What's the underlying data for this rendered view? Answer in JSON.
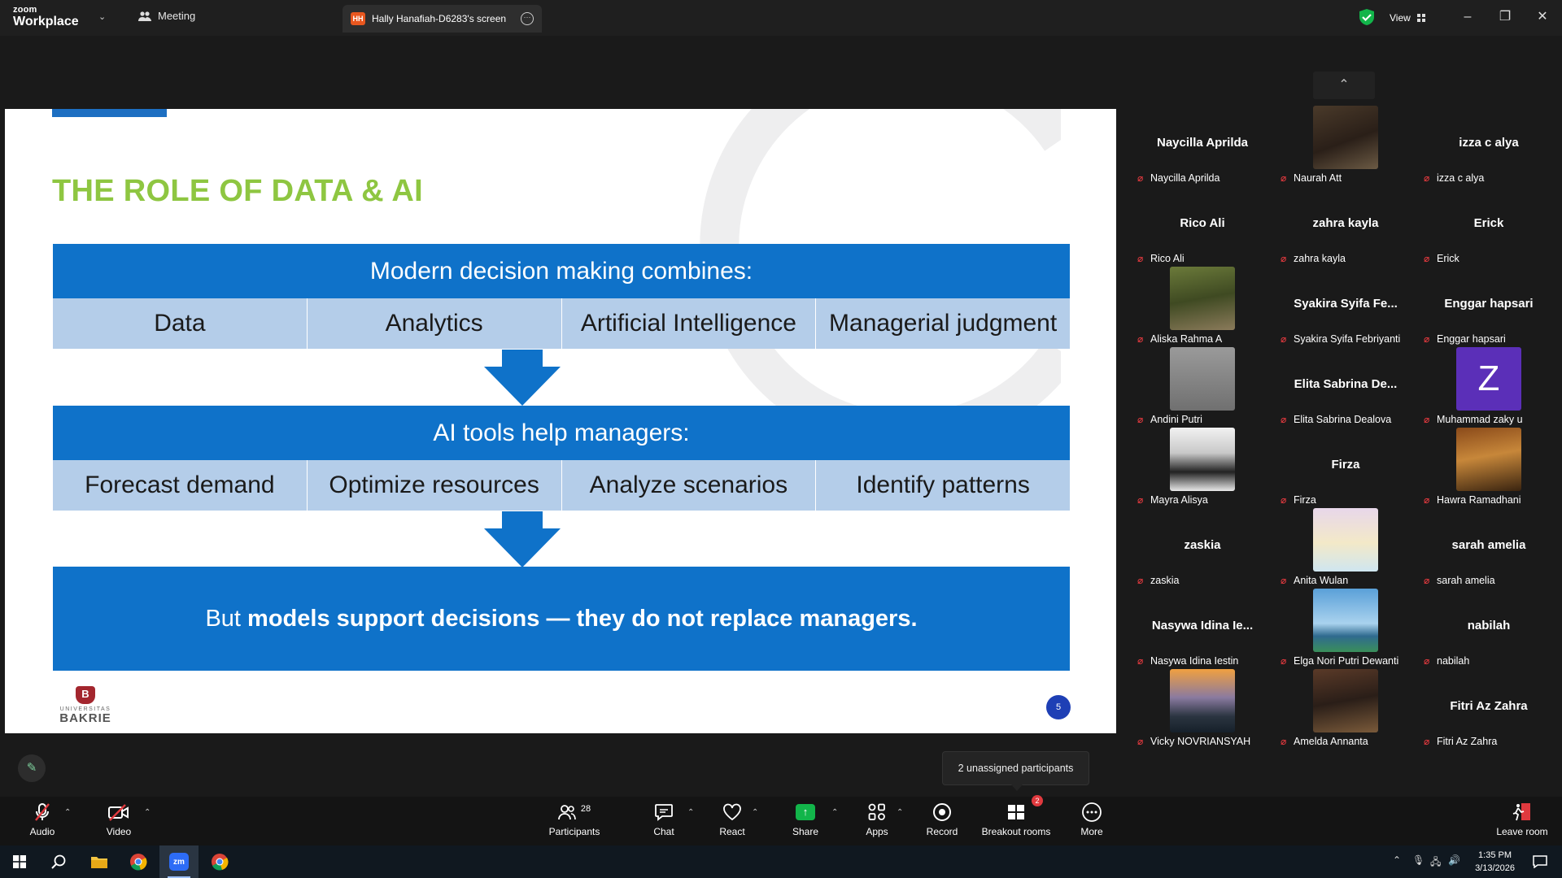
{
  "titlebar": {
    "logo_top": "zoom",
    "logo_bottom": "Workplace",
    "meeting_label": "Meeting",
    "screen_badge": "HH",
    "screen_tab": "Hally Hanafiah-D6283's screen",
    "view_label": "View"
  },
  "slide": {
    "title": "THE ROLE OF DATA & AI",
    "band1": "Modern decision making combines:",
    "row1": [
      "Data",
      "Analytics",
      "Artificial Intelligence",
      "Managerial judgment"
    ],
    "band2": "AI tools help managers:",
    "row2": [
      "Forecast demand",
      "Optimize resources",
      "Analyze scenarios",
      "Identify patterns"
    ],
    "conclusion_pre": "But ",
    "conclusion_bold": "models support decisions — they do not replace managers.",
    "logo_small": "UNIVERSITAS",
    "logo_name": "BAKRIE",
    "page_number": "5"
  },
  "participants": [
    {
      "big": "Naycilla Aprilda",
      "label": "Naycilla Aprilda",
      "video": "none"
    },
    {
      "big": "",
      "label": "Naurah Att",
      "video": "photo-hand"
    },
    {
      "big": "izza c alya",
      "label": "izza c alya",
      "video": "none"
    },
    {
      "big": "Rico Ali",
      "label": "Rico Ali",
      "video": "none"
    },
    {
      "big": "zahra kayla",
      "label": "zahra kayla",
      "video": "none"
    },
    {
      "big": "Erick",
      "label": "Erick",
      "video": "none"
    },
    {
      "big": "",
      "label": "Aliska Rahma A",
      "video": "photo-garden"
    },
    {
      "big": "Syakira Syifa Fe...",
      "label": "Syakira Syifa Febriyanti",
      "video": "none"
    },
    {
      "big": "Enggar hapsari",
      "label": "Enggar hapsari",
      "video": "none"
    },
    {
      "big": "",
      "label": "Andini Putri",
      "video": "photo-blur"
    },
    {
      "big": "Elita Sabrina De...",
      "label": "Elita Sabrina Dealova",
      "video": "none"
    },
    {
      "big": "",
      "label": "Muhammad zaky u",
      "video": "avatar-z",
      "initial": "Z"
    },
    {
      "big": "",
      "label": "Mayra Alisya",
      "video": "photo-hijab"
    },
    {
      "big": "Firza",
      "label": "Firza",
      "video": "none"
    },
    {
      "big": "",
      "label": "Hawra Ramadhani",
      "video": "photo-warm"
    },
    {
      "big": "zaskia",
      "label": "zaskia",
      "video": "none"
    },
    {
      "big": "",
      "label": "Anita Wulan",
      "video": "photo-cat"
    },
    {
      "big": "sarah amelia",
      "label": "sarah amelia",
      "video": "none"
    },
    {
      "big": "Nasywa Idina Ie...",
      "label": "Nasywa Idina Iestin",
      "video": "none"
    },
    {
      "big": "",
      "label": "Elga Nori Putri Dewanti",
      "video": "photo-beach"
    },
    {
      "big": "nabilah",
      "label": "nabilah",
      "video": "none"
    },
    {
      "big": "",
      "label": "Vicky NOVRIANSYAH",
      "video": "photo-mountain"
    },
    {
      "big": "",
      "label": "Amelda Annanta",
      "video": "photo-hat"
    },
    {
      "big": "Fitri Az Zahra",
      "label": "Fitri Az Zahra",
      "video": "none"
    }
  ],
  "tooltip": "2 unassigned participants",
  "toolbar": {
    "audio": "Audio",
    "video": "Video",
    "participants": "Participants",
    "participants_count": "28",
    "chat": "Chat",
    "react": "React",
    "share": "Share",
    "apps": "Apps",
    "record": "Record",
    "breakout": "Breakout rooms",
    "breakout_badge": "2",
    "more": "More",
    "leave": "Leave room"
  },
  "taskbar": {
    "time": "1:35 PM",
    "date": "3/13/2026"
  },
  "colors": {
    "slide_blue": "#0f72c9",
    "slide_light": "#b4cde9",
    "title_green": "#8ec641",
    "share_green": "#12b54a",
    "mute_red": "#e0393e"
  }
}
